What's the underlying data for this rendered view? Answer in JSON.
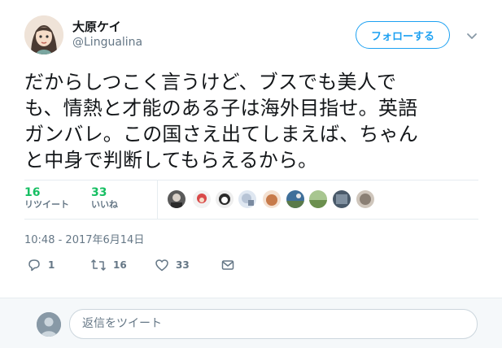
{
  "author": {
    "display_name": "大原ケイ",
    "handle": "@Lingualina"
  },
  "follow_button": {
    "label": "フォローする"
  },
  "tweet": {
    "lines": [
      "だからしつこく言うけど、ブスでも美人で",
      "も、情熱と才能のある子は海外目指せ。英語",
      "ガンバレ。この国さえ出てしまえば、ちゃん",
      "と中身で判断してもらえるから。"
    ],
    "timestamp": "10:48 - 2017年6月14日"
  },
  "stats": {
    "retweets": {
      "count": "16",
      "label": "リツイート"
    },
    "likes": {
      "count": "33",
      "label": "いいね"
    }
  },
  "likers": [
    {
      "icon": "avatar-1",
      "color": "#5a5a5a"
    },
    {
      "icon": "avatar-2",
      "color": "#d94a4a"
    },
    {
      "icon": "avatar-3",
      "color": "#2b2b2b"
    },
    {
      "icon": "avatar-4",
      "color": "#b7c4d6"
    },
    {
      "icon": "avatar-5",
      "color": "#c77a4a"
    },
    {
      "icon": "avatar-6",
      "color": "#3f6f9a"
    },
    {
      "icon": "avatar-7",
      "color": "#6b8f4e"
    },
    {
      "icon": "avatar-8",
      "color": "#4a5a6a"
    },
    {
      "icon": "avatar-9",
      "color": "#8a7f74"
    }
  ],
  "actions": {
    "reply_count": "1",
    "retweet_count": "16",
    "like_count": "33"
  },
  "reply": {
    "placeholder": "返信をツイート"
  },
  "colors": {
    "accent": "#1da1f2",
    "retweet_green": "#17bf63",
    "muted": "#657786"
  }
}
